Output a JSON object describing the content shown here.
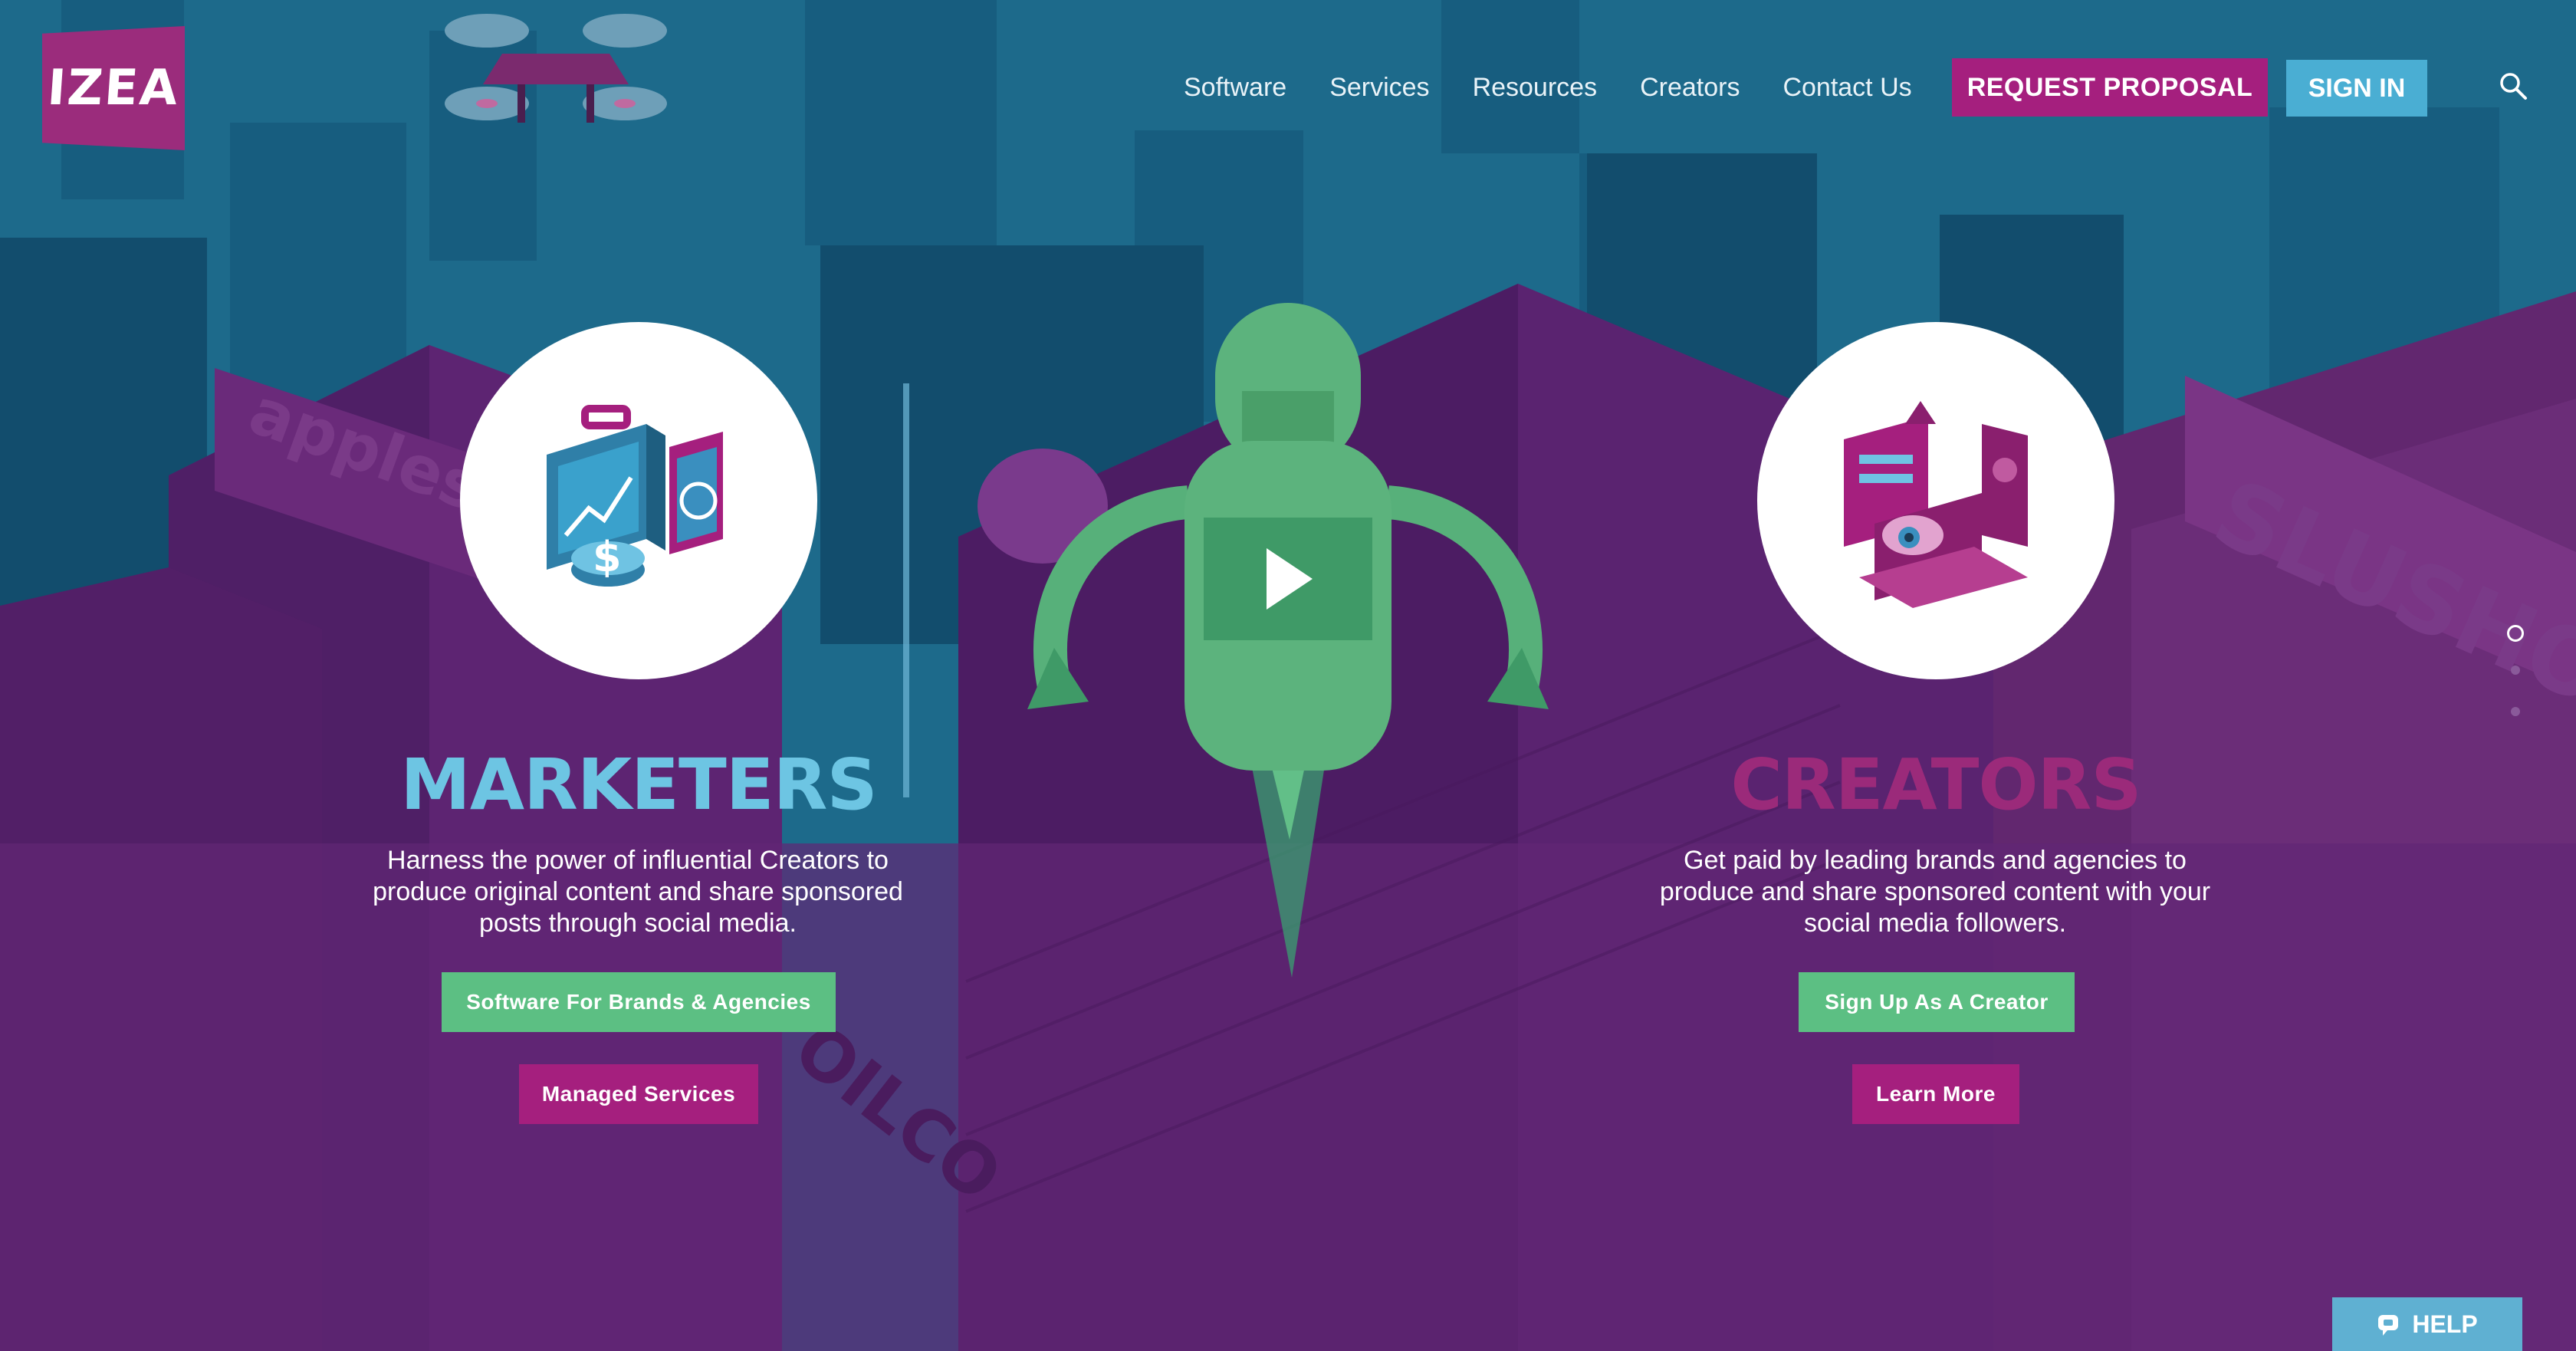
{
  "header": {
    "logo_text": "IZEA",
    "nav": [
      "Software",
      "Services",
      "Resources",
      "Creators",
      "Contact Us"
    ],
    "request_proposal": "REQUEST PROPOSAL",
    "sign_in": "SIGN IN"
  },
  "marketers": {
    "title": "MARKETERS",
    "description": "Harness the power of influential Creators to produce original content and share sponsored posts through social media.",
    "primary_button": "Software For Brands & Agencies",
    "secondary_button": "Managed Services"
  },
  "creators": {
    "title": "CREATORS",
    "description": "Get paid by leading brands and agencies to produce and share sponsored content with your social media followers.",
    "primary_button": "Sign Up As A Creator",
    "secondary_button": "Learn More"
  },
  "background_signs": [
    "applesoft",
    "SLUSHO!",
    "OILCO"
  ],
  "help_label": "HELP",
  "colors": {
    "sky": "#1f6a8c",
    "purple": "#5e2370",
    "accent_pink": "#a51f7e",
    "accent_blue": "#4aaed3",
    "accent_green": "#5cbf83",
    "marketers_title": "#6dc5e3",
    "creators_title": "#9b2a7a"
  },
  "icons": [
    "drone-icon",
    "briefcase-chart-icon",
    "rocket-play-icon",
    "laptop-media-icon",
    "search-icon",
    "help-chat-icon"
  ],
  "carousel": {
    "slides": 3,
    "active": 1
  }
}
